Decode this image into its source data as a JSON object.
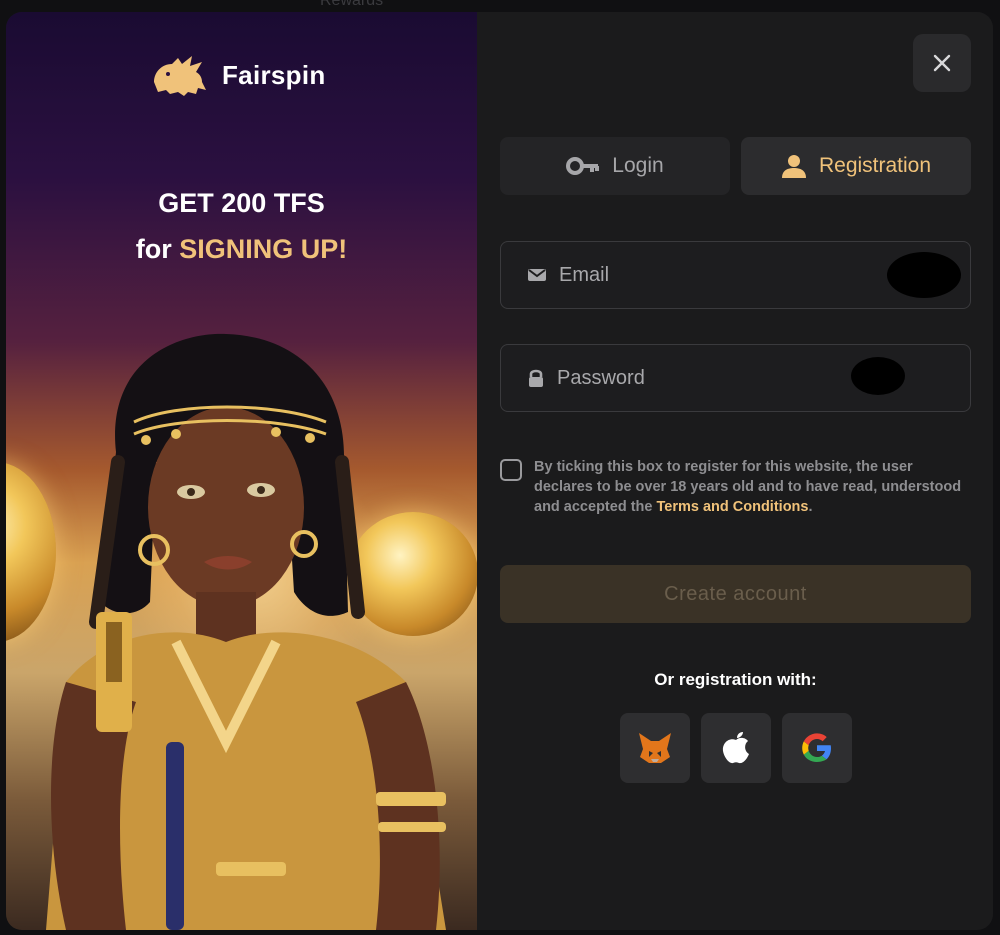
{
  "backdrop": {
    "partial_text": "Rewards"
  },
  "promo": {
    "brand": "Fairspin",
    "headline_line1": "GET 200 TFS",
    "headline_for": "for",
    "headline_accent": "SIGNING UP!"
  },
  "tabs": [
    {
      "label": "Login",
      "icon": "key-icon",
      "active": false
    },
    {
      "label": "Registration",
      "icon": "user-icon",
      "active": true
    }
  ],
  "form": {
    "email_placeholder": "Email",
    "password_placeholder": "Password",
    "consent_text": "By ticking this box to register for this website, the user declares to be over 18 years old and to have read, understood and accepted the",
    "terms_link": "Terms and Conditions",
    "consent_end": ".",
    "create_button": "Create account",
    "or_text": "Or registration with:"
  },
  "social": [
    {
      "name": "metamask",
      "icon": "metamask-fox-icon"
    },
    {
      "name": "apple",
      "icon": "apple-icon"
    },
    {
      "name": "google",
      "icon": "google-icon"
    }
  ],
  "colors": {
    "accent": "#f0c27a",
    "panel": "#1b1b1c",
    "field_border": "#3a3a3d"
  }
}
